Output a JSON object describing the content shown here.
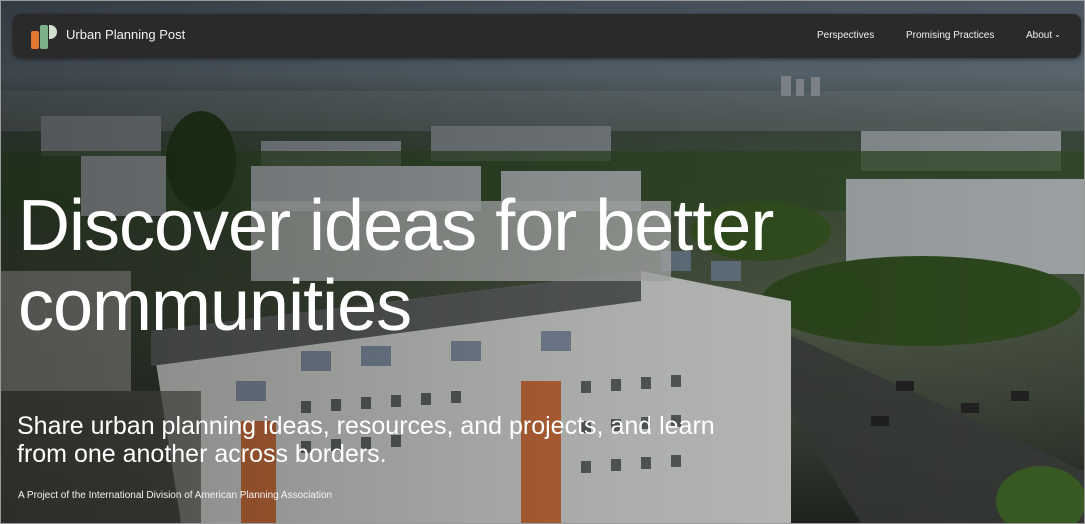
{
  "header": {
    "brand_name": "Urban Planning Post",
    "logo_icon": "upp-logo-icon",
    "nav": {
      "perspectives": "Perspectives",
      "promising_practices": "Promising Practices",
      "about": "About",
      "about_icon": "chevron-down-icon"
    }
  },
  "hero": {
    "title": "Discover ideas for better communities",
    "subtitle": "Share urban planning ideas, resources, and projects, and learn from one another across borders.",
    "credit": "A Project of the International Division of American Planning Association",
    "background_image": "aerial-city-apartment-blocks"
  },
  "colors": {
    "navbar": "#2a2a2a",
    "logo_orange": "#e1762e",
    "logo_green": "#7cb08a",
    "logo_light": "#cfe0cf",
    "text": "#ffffff"
  }
}
